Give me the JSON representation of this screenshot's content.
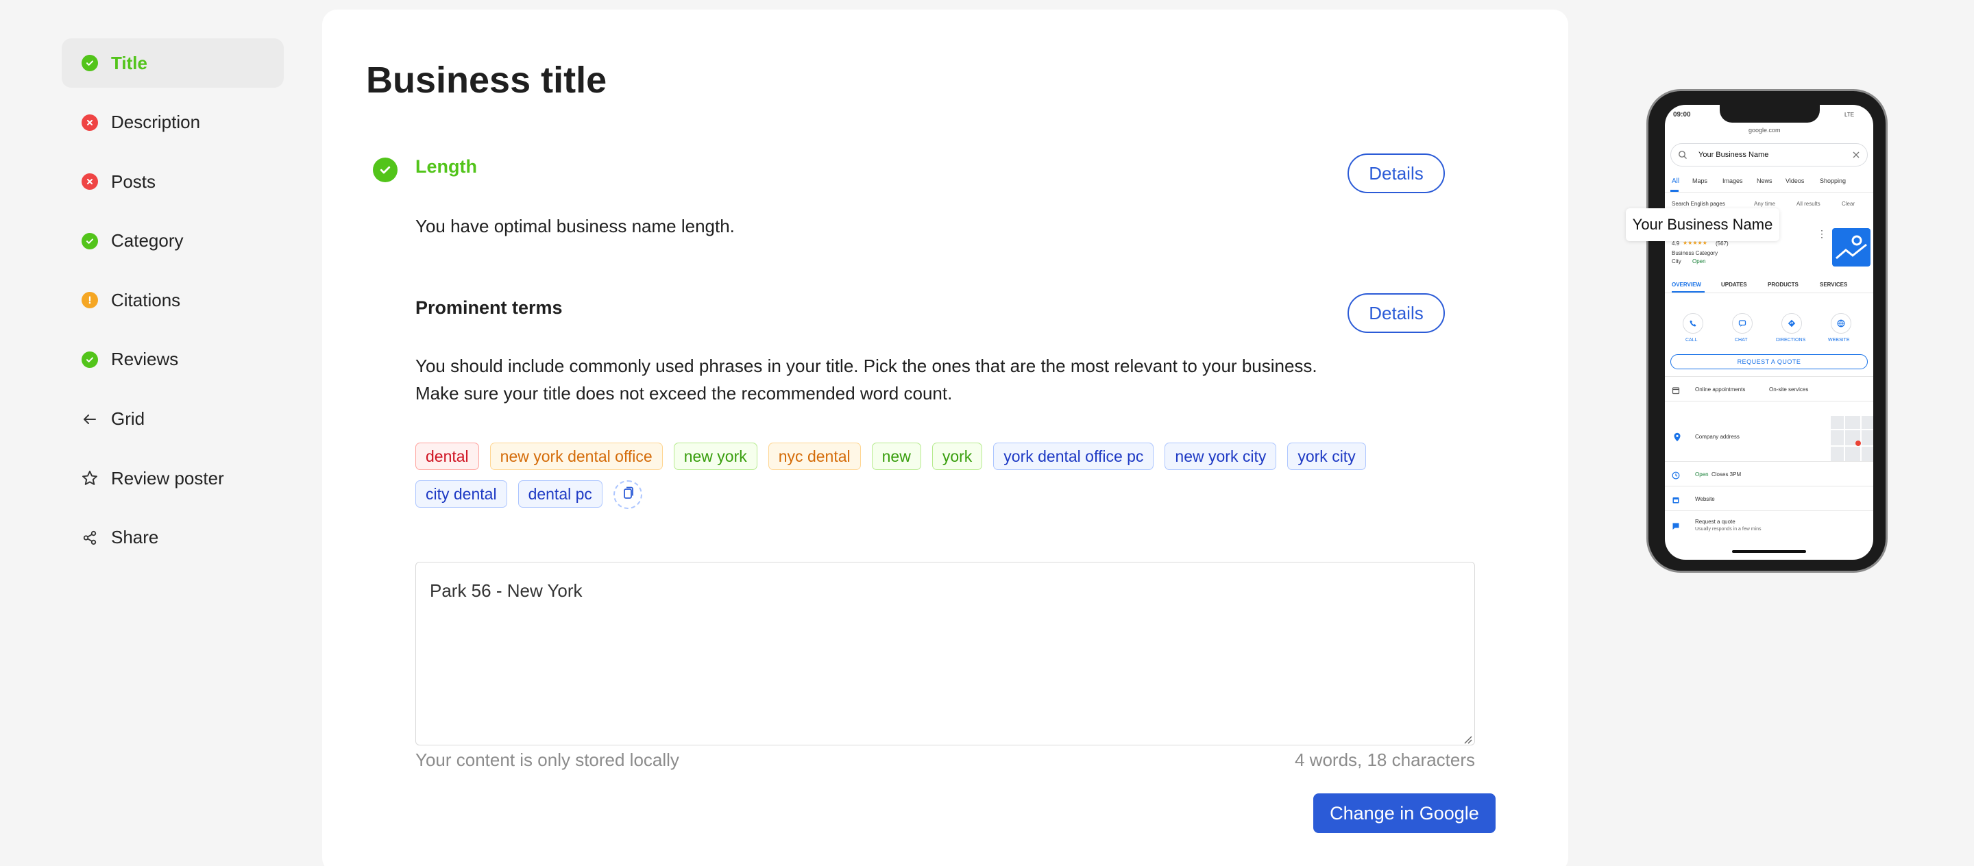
{
  "sidebar": {
    "items": [
      {
        "label": "Title",
        "status": "ok"
      },
      {
        "label": "Description",
        "status": "error"
      },
      {
        "label": "Posts",
        "status": "error"
      },
      {
        "label": "Category",
        "status": "ok"
      },
      {
        "label": "Citations",
        "status": "warning"
      },
      {
        "label": "Reviews",
        "status": "ok"
      },
      {
        "label": "Grid",
        "icon": "arrow-left-icon"
      },
      {
        "label": "Review poster",
        "icon": "star-icon"
      },
      {
        "label": "Share",
        "icon": "share-icon"
      }
    ]
  },
  "main": {
    "title": "Business title",
    "length": {
      "heading": "Length",
      "text": "You have optimal business name length.",
      "details_label": "Details"
    },
    "prominent": {
      "heading": "Prominent terms",
      "text_line1": "You should include commonly used phrases in your title. Pick the ones that are the most relevant to your business.",
      "text_line2": "Make sure your title does not exceed the recommended word count.",
      "details_label": "Details"
    },
    "tags": [
      {
        "label": "dental",
        "color": "red"
      },
      {
        "label": "new york dental office",
        "color": "orange"
      },
      {
        "label": "new york",
        "color": "green"
      },
      {
        "label": "nyc dental",
        "color": "orange"
      },
      {
        "label": "new",
        "color": "green"
      },
      {
        "label": "york",
        "color": "green"
      },
      {
        "label": "york dental office pc",
        "color": "blue"
      },
      {
        "label": "new york city",
        "color": "blue"
      },
      {
        "label": "york city",
        "color": "blue"
      },
      {
        "label": "city dental",
        "color": "blue"
      },
      {
        "label": "dental pc",
        "color": "blue"
      }
    ],
    "editor": {
      "value": "Park 56 - New York",
      "storage_note": "Your content is only stored locally",
      "counts": "4 words, 18 characters"
    },
    "change_button": "Change in Google"
  },
  "preview": {
    "tooltip": "Your Business Name",
    "status_time": "09:00",
    "status_right": "LTE",
    "url": "google.com",
    "search_value": "Your Business Name",
    "tabs": [
      "All",
      "Maps",
      "Images",
      "News",
      "Videos",
      "Shopping"
    ],
    "filters": [
      "Search English pages",
      "Any time",
      "All results",
      "Clear"
    ],
    "rating": "4.9",
    "stars": "★★★★★",
    "review_count": "(567)",
    "category": "Business Category",
    "city": "City",
    "open": "Open",
    "sections": [
      "OVERVIEW",
      "UPDATES",
      "PRODUCTS",
      "SERVICES"
    ],
    "actions": [
      "CALL",
      "CHAT",
      "DIRECTIONS",
      "WEBSITE"
    ],
    "quote_button": "REQUEST A QUOTE",
    "online": "Online appointments",
    "onsite": "On-site services",
    "address": "Company address",
    "hours_open": "Open",
    "hours_close": "Closes 3PM",
    "website": "Website",
    "request": "Request a quote",
    "responds": "Usually responds in a few mins"
  },
  "colors": {
    "accent": "#2b5bd7",
    "ok": "#52c41a",
    "error": "#ef4444",
    "warning": "#f5a623"
  }
}
